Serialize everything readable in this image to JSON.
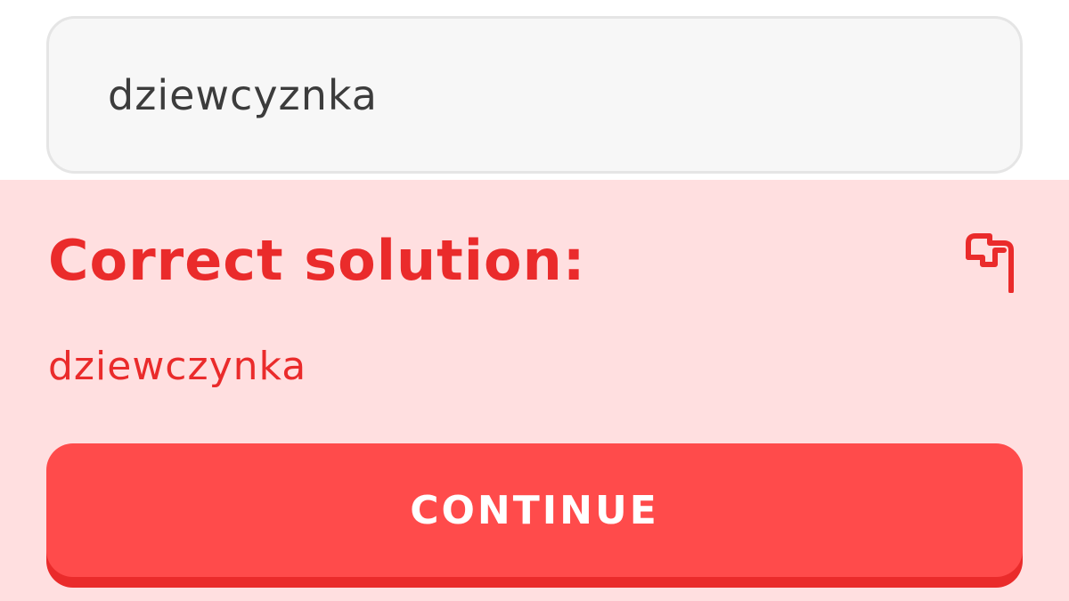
{
  "answer": {
    "value": "dziewcyznka"
  },
  "feedback": {
    "title": "Correct solution:",
    "solution": "dziewczynka",
    "report_icon": "flag-icon"
  },
  "continue_button": {
    "label": "CONTINUE"
  },
  "colors": {
    "error_text": "#ea2b2b",
    "panel_background": "#ffdfe0",
    "button_background": "#ff4b4b",
    "button_shadow": "#ea2b2b",
    "input_background": "#f7f7f7",
    "input_border": "#e5e5e5",
    "input_text": "#3c3c3c"
  }
}
